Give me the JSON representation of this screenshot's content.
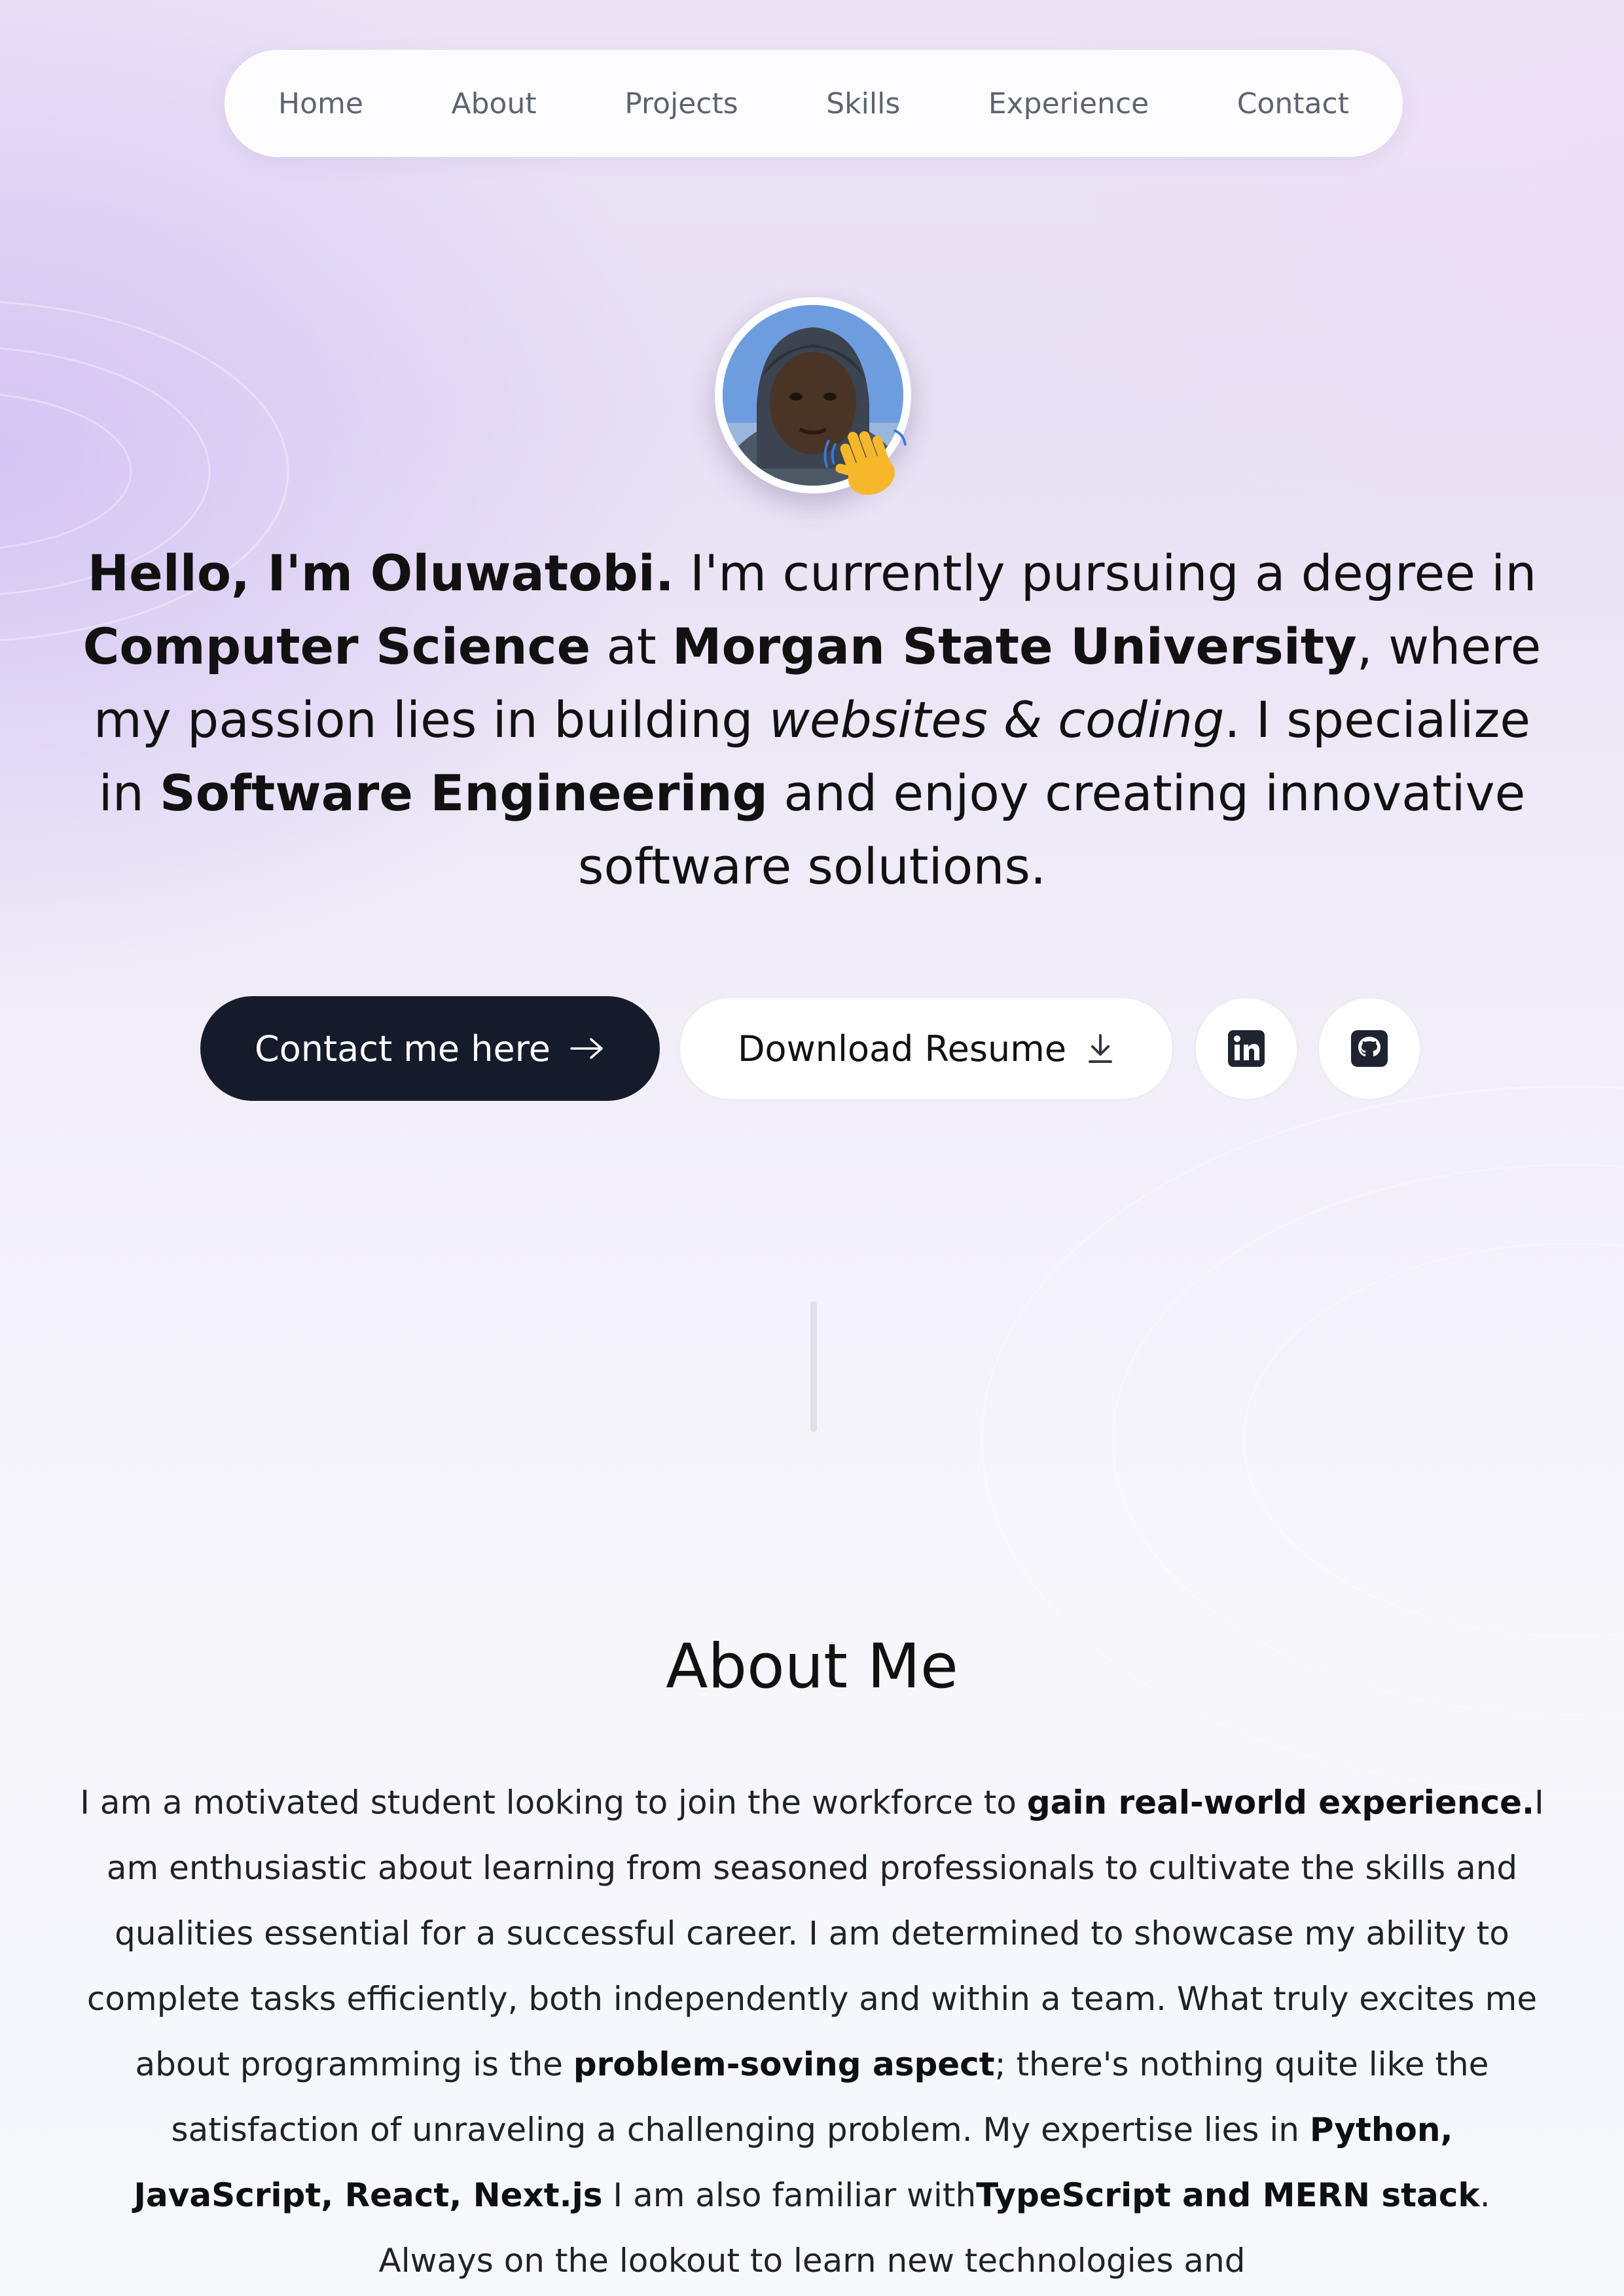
{
  "nav": {
    "items": [
      "Home",
      "About",
      "Projects",
      "Skills",
      "Experience",
      "Contact"
    ]
  },
  "avatar": {
    "icon": "waving-hand-emoji"
  },
  "intro": {
    "p1": "Hello, I'm Oluwatobi.",
    "p2": " I'm currently pursuing a degree in ",
    "p3": "Computer Science",
    "p4": " at ",
    "p5": "Morgan State University",
    "p6": ", where my passion lies in building ",
    "p7": "websites & coding",
    "p8": ". I specialize in ",
    "p9": "Software Engineering",
    "p10": " and enjoy creating innovative software solutions."
  },
  "buttons": {
    "contact": "Contact me here",
    "contact_icon": "arrow-right-icon",
    "resume": "Download Resume",
    "resume_icon": "download-icon",
    "linkedin_icon": "linkedin-icon",
    "github_icon": "github-icon"
  },
  "about": {
    "title": "About Me",
    "t1": "I am a motivated student looking to join the workforce to ",
    "t2": "gain real-world experience.",
    "t3": "I am enthusiastic about learning from seasoned professionals to cultivate the skills and qualities essential for a successful career. I am determined to showcase my ability to complete tasks efficiently, both independently and within a team. What truly excites me about programming is the ",
    "t4": "problem-soving aspect",
    "t5": "; there's nothing quite like the satisfaction of unraveling a challenging problem. My expertise lies in ",
    "t6": "Python, JavaScript, React, Next.js",
    "t7": " I am also familiar with",
    "t8": "TypeScript and MERN stack",
    "t9": ". Always on the lookout to learn new technologies and"
  },
  "colors": {
    "primary_button": "#151b2b",
    "accent_background": "#e8e0f4"
  }
}
